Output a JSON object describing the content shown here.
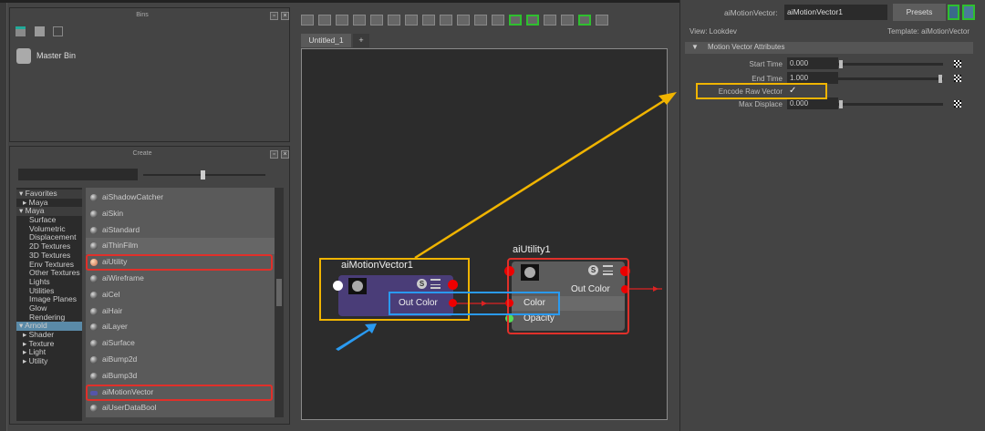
{
  "bins": {
    "title": "Bins",
    "master_bin": "Master Bin"
  },
  "create": {
    "title": "Create",
    "tree": [
      {
        "label": "Favorites",
        "level": 0,
        "exp": "down",
        "sel": false
      },
      {
        "label": "Maya",
        "level": 1,
        "exp": "right",
        "sel": false
      },
      {
        "label": "Maya",
        "level": 0,
        "exp": "down",
        "sel": false
      },
      {
        "label": "Surface",
        "level": 2
      },
      {
        "label": "Volumetric",
        "level": 2
      },
      {
        "label": "Displacement",
        "level": 2
      },
      {
        "label": "2D Textures",
        "level": 2
      },
      {
        "label": "3D Textures",
        "level": 2
      },
      {
        "label": "Env Textures",
        "level": 2
      },
      {
        "label": "Other Textures",
        "level": 2
      },
      {
        "label": "Lights",
        "level": 2
      },
      {
        "label": "Utilities",
        "level": 2
      },
      {
        "label": "Image Planes",
        "level": 2
      },
      {
        "label": "Glow",
        "level": 2
      },
      {
        "label": "Rendering",
        "level": 2
      },
      {
        "label": "Arnold",
        "level": 0,
        "exp": "down",
        "sel": true
      },
      {
        "label": "Shader",
        "level": 1,
        "exp": "right"
      },
      {
        "label": "Texture",
        "level": 1,
        "exp": "right"
      },
      {
        "label": "Light",
        "level": 1,
        "exp": "right"
      },
      {
        "label": "Utility",
        "level": 1,
        "exp": "right"
      }
    ],
    "items": [
      "aiShadowCatcher",
      "aiSkin",
      "aiStandard",
      "aiThinFilm",
      "aiUtility",
      "aiWireframe",
      "aiCel",
      "aiHair",
      "aiLayer",
      "aiSurface",
      "aiBump2d",
      "aiBump3d",
      "aiMotionVector",
      "aiUserDataBool"
    ],
    "highlighted": [
      "aiUtility",
      "aiMotionVector"
    ]
  },
  "editor": {
    "tab": "Untitled_1",
    "add_tab": "+",
    "node1": {
      "name": "aiMotionVector1",
      "out": "Out Color",
      "s": "S"
    },
    "node2": {
      "name": "aiUtility1",
      "out": "Out Color",
      "in1": "Color",
      "in2": "Opacity",
      "s": "S"
    },
    "colors": {
      "yellow": "#f0b400",
      "blue": "#2a9af0",
      "red": "#e0302a"
    }
  },
  "attr": {
    "type_label": "aiMotionVector:",
    "node_name": "aiMotionVector1",
    "presets": "Presets",
    "view": "View: Lookdev",
    "template": "Template: aiMotionVector",
    "section": "Motion Vector Attributes",
    "start_time_label": "Start Time",
    "start_time": "0.000",
    "end_time_label": "End Time",
    "end_time": "1.000",
    "encode_label": "Encode Raw Vector",
    "encode_check": "✓",
    "max_displace_label": "Max Displace",
    "max_displace": "0.000"
  }
}
